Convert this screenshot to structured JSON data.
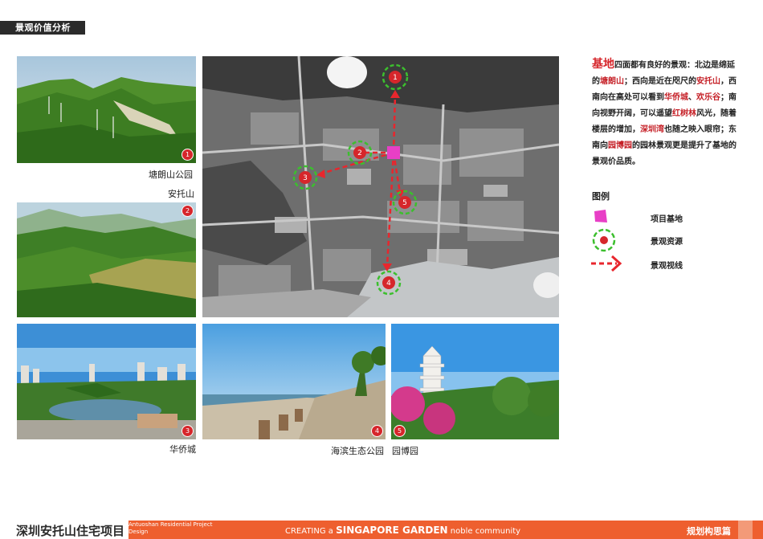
{
  "header": {
    "title": "景观价值分析"
  },
  "photos": [
    {
      "id": "tanglang",
      "badge": "1",
      "caption": "塘朗山公园"
    },
    {
      "id": "antuo",
      "badge": "2",
      "caption": "安托山"
    },
    {
      "id": "huaqiao",
      "badge": "3",
      "caption": "华侨城"
    },
    {
      "id": "binhai",
      "badge": "4",
      "caption": "海滨生态公园"
    },
    {
      "id": "yuanbo",
      "badge": "5",
      "caption": "园博园"
    }
  ],
  "map": {
    "markers": [
      "1",
      "2",
      "3",
      "4",
      "5"
    ]
  },
  "description": {
    "lead": "基地",
    "t1": "四面都有良好的景观：北边是绵延的",
    "h1": "塘朗山",
    "t2": "；西向是近在咫尺的",
    "h2": "安托山",
    "t3": "，西南向在高处可以看到",
    "h3": "华侨城",
    "t4": "、",
    "h4": "欢乐谷",
    "t5": "；南向视野开阔，可以遥望",
    "h5": "红树林",
    "t6": "风光，随着楼层的增加，",
    "h6": "深圳湾",
    "t7": "也随之映入眼帘；东南向",
    "h7": "园博园",
    "t8": "的园林景观更是提升了基地的景观价品质。"
  },
  "legend": {
    "title": "图例",
    "items": [
      {
        "icon": "pink-square-icon",
        "label": "项目基地"
      },
      {
        "icon": "green-circle-dot-icon",
        "label": "景观资源"
      },
      {
        "icon": "red-dashed-arrow-icon",
        "label": "景观视线"
      }
    ]
  },
  "footer": {
    "project": "深圳安托山住宅项目",
    "sub": "Antuoshan Residential Project Design",
    "slogan_pre": "CREATING a",
    "slogan_mid": "SINGAPORE GARDEN",
    "slogan_post": "noble community",
    "section": "规划构思篇"
  },
  "colors": {
    "accent_red": "#d6262b",
    "footer_orange": "#ee5f2f",
    "site_pink": "#e83fc6",
    "resource_green": "#3cbf2e"
  }
}
